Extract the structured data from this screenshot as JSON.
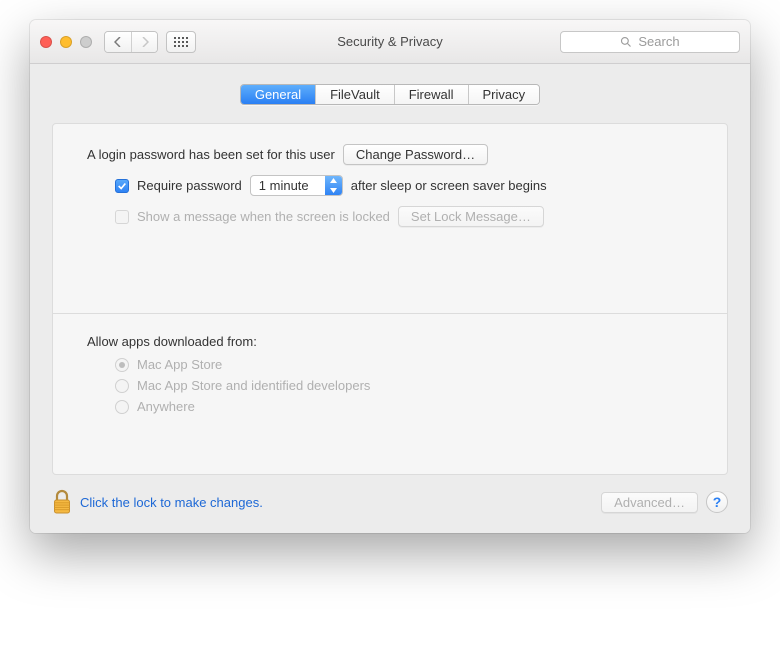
{
  "window": {
    "title": "Security & Privacy"
  },
  "search": {
    "placeholder": "Search"
  },
  "tabs": [
    {
      "label": "General",
      "selected": true
    },
    {
      "label": "FileVault",
      "selected": false
    },
    {
      "label": "Firewall",
      "selected": false
    },
    {
      "label": "Privacy",
      "selected": false
    }
  ],
  "login": {
    "message": "A login password has been set for this user",
    "change_password_button": "Change Password…",
    "require_password_prefix": "Require password",
    "require_password_delay": "1 minute",
    "require_password_suffix": "after sleep or screen saver begins",
    "show_message_label": "Show a message when the screen is locked",
    "set_lock_message_button": "Set Lock Message…"
  },
  "gatekeeper": {
    "heading": "Allow apps downloaded from:",
    "options": [
      {
        "label": "Mac App Store",
        "selected": true
      },
      {
        "label": "Mac App Store and identified developers",
        "selected": false
      },
      {
        "label": "Anywhere",
        "selected": false
      }
    ]
  },
  "footer": {
    "lock_hint": "Click the lock to make changes.",
    "advanced_button": "Advanced…",
    "help_label": "?"
  }
}
